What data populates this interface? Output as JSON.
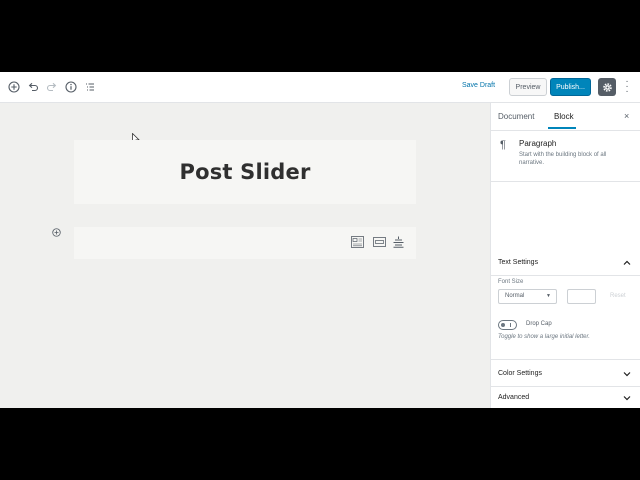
{
  "toolbar": {
    "add_block_icon": "plus-circle-icon",
    "undo_icon": "undo-icon",
    "redo_icon": "redo-icon",
    "info_icon": "info-icon",
    "outline_icon": "list-icon",
    "save_draft_label": "Save Draft",
    "preview_label": "Preview",
    "publish_label": "Publish...",
    "settings_icon": "gear-icon",
    "more_icon": "more-vertical-icon"
  },
  "editor": {
    "title_block_text": "Post Slider",
    "block_toolbar_icons": [
      "post-grid-icon",
      "slider-icon",
      "align-icon"
    ]
  },
  "sidebar": {
    "tabs": [
      {
        "label": "Document"
      },
      {
        "label": "Block"
      }
    ],
    "close_label": "×",
    "block_card": {
      "icon": "¶",
      "title": "Paragraph",
      "description": "Start with the building block of all narrative."
    },
    "text_settings": {
      "title": "Text Settings",
      "font_size_label": "Font Size",
      "font_size_value": "Normal",
      "reset_label": "Reset",
      "drop_cap_label": "Drop Cap",
      "drop_cap_help": "Toggle to show a large initial letter."
    },
    "color_settings": {
      "title": "Color Settings"
    },
    "advanced": {
      "title": "Advanced"
    }
  },
  "colors": {
    "accent": "#0085ba",
    "canvas": "#f0f0ee",
    "block_bg": "#f6f6f4"
  }
}
